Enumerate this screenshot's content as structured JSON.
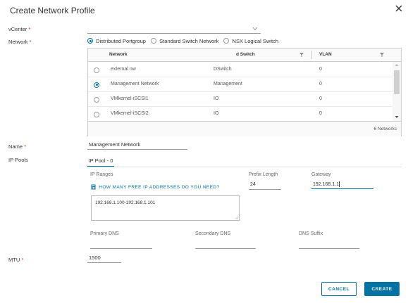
{
  "dialog": {
    "title": "Create Network Profile"
  },
  "form": {
    "vcenter_label": "vCenter",
    "network_label": "Network",
    "name_label": "Name",
    "ip_pools_label": "IP Pools",
    "mtu_label": "MTU",
    "required_mark": "*",
    "name_value": "Management Network",
    "mtu_value": "1500"
  },
  "network_types": [
    {
      "label": "Distributed Portgroup",
      "selected": true
    },
    {
      "label": "Standard Switch Network",
      "selected": false
    },
    {
      "label": "NSX Logical Switch",
      "selected": false
    }
  ],
  "network_grid": {
    "columns": [
      "Network",
      "d Switch",
      "VLAN"
    ],
    "rows": [
      {
        "network": "external nw",
        "switch": "DSwitch",
        "vlan": "0",
        "selected": false
      },
      {
        "network": "Management Network",
        "switch": "Management",
        "vlan": "0",
        "selected": true
      },
      {
        "network": "VMkernel-iSCSI1",
        "switch": "IO",
        "vlan": "0",
        "selected": false
      },
      {
        "network": "VMkernel-iSCSI2",
        "switch": "IO",
        "vlan": "0",
        "selected": false
      }
    ],
    "footer": "6 Networks"
  },
  "ip_pool": {
    "tab_label": "IP Pool - 0",
    "ip_ranges_label": "IP Ranges",
    "help_link": "HOW MANY FREE IP ADDRESSES DO YOU NEED?",
    "ip_ranges_value": "192.168.1.100-192.168.1.101",
    "prefix_label": "Prefix Length",
    "prefix_value": "24",
    "gateway_label": "Gateway",
    "gateway_value": "192.168.1.1",
    "primary_dns_label": "Primary DNS",
    "secondary_dns_label": "Secondary DNS",
    "dns_suffix_label": "DNS Suffix"
  },
  "actions": {
    "cancel": "CANCEL",
    "create": "CREATE"
  },
  "colors": {
    "accent": "#0072a3",
    "required": "#c92100"
  }
}
